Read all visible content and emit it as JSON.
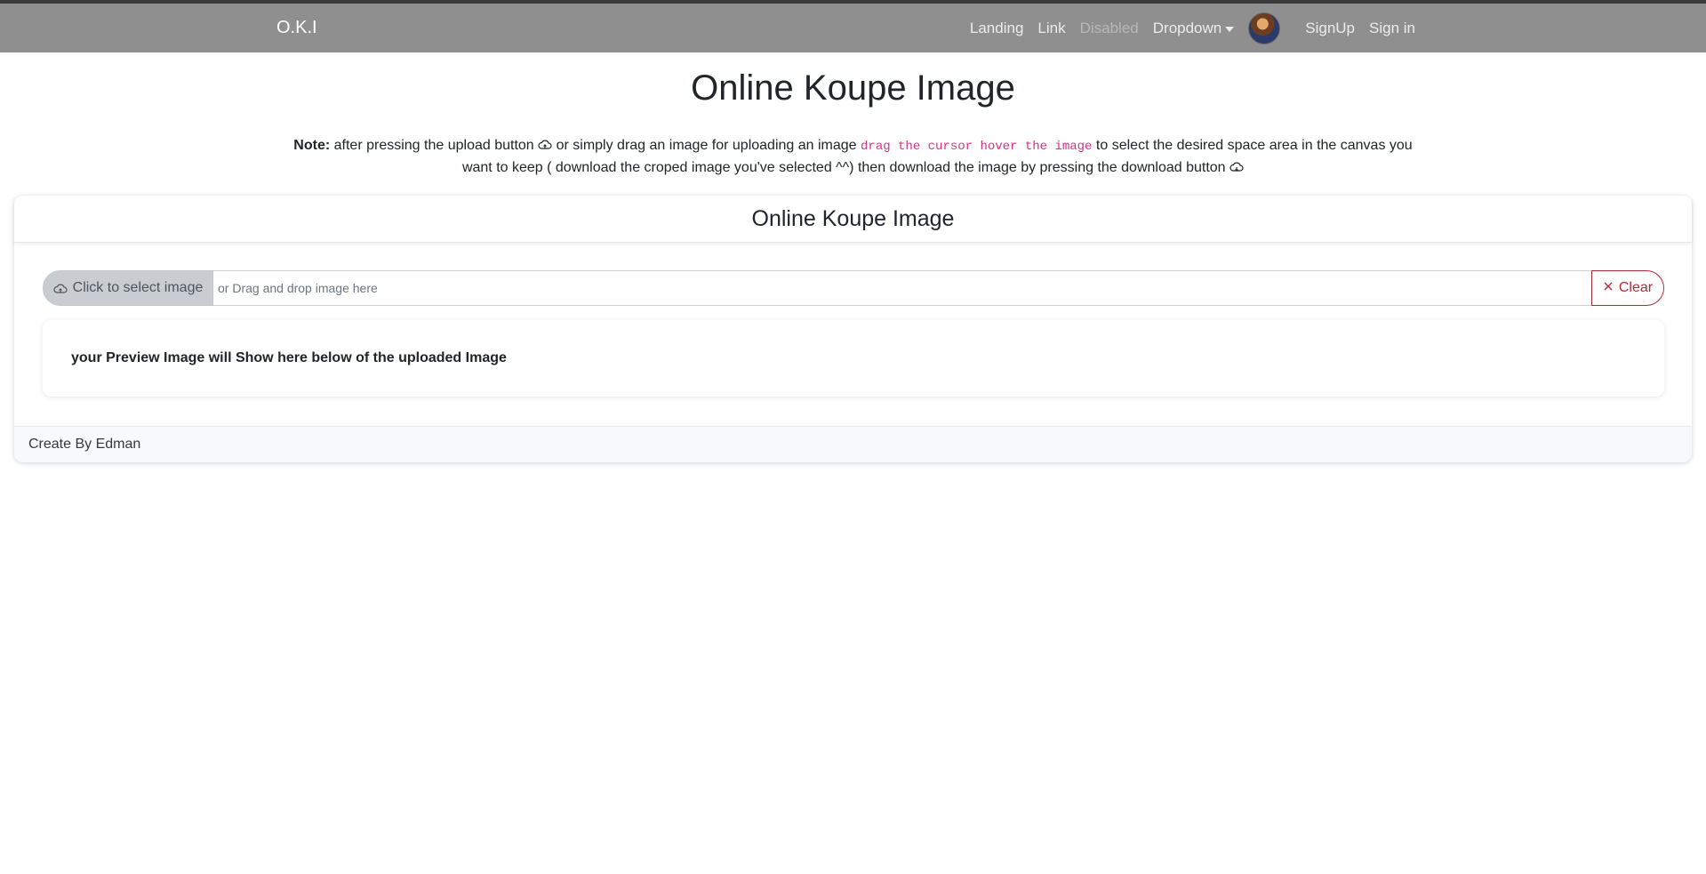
{
  "navbar": {
    "brand": "O.K.I",
    "links": {
      "landing": "Landing",
      "link": "Link",
      "disabled": "Disabled",
      "dropdown": "Dropdown",
      "signup": "SignUp",
      "signin": "Sign in"
    }
  },
  "page": {
    "title": "Online Koupe Image"
  },
  "note": {
    "label": "Note:",
    "part1": "after pressing the upload button",
    "part2": "or simply drag an image for uploading an image",
    "code": "drag the cursor hover the image",
    "part3": "to select the desired space area in the canvas you want to keep ( download the croped image you've selected ^^) then download the image by pressing the download button"
  },
  "card": {
    "header": "Online Koupe Image",
    "select_button": "Click to select image",
    "drop_placeholder": "or Drag and drop image here",
    "clear_button": "Clear",
    "preview_text": "your Preview Image will Show here below of the uploaded Image",
    "footer": "Create By Edman"
  },
  "colors": {
    "navbar": "#8f8f8f",
    "danger": "#b02a37",
    "code": "#d63384"
  }
}
